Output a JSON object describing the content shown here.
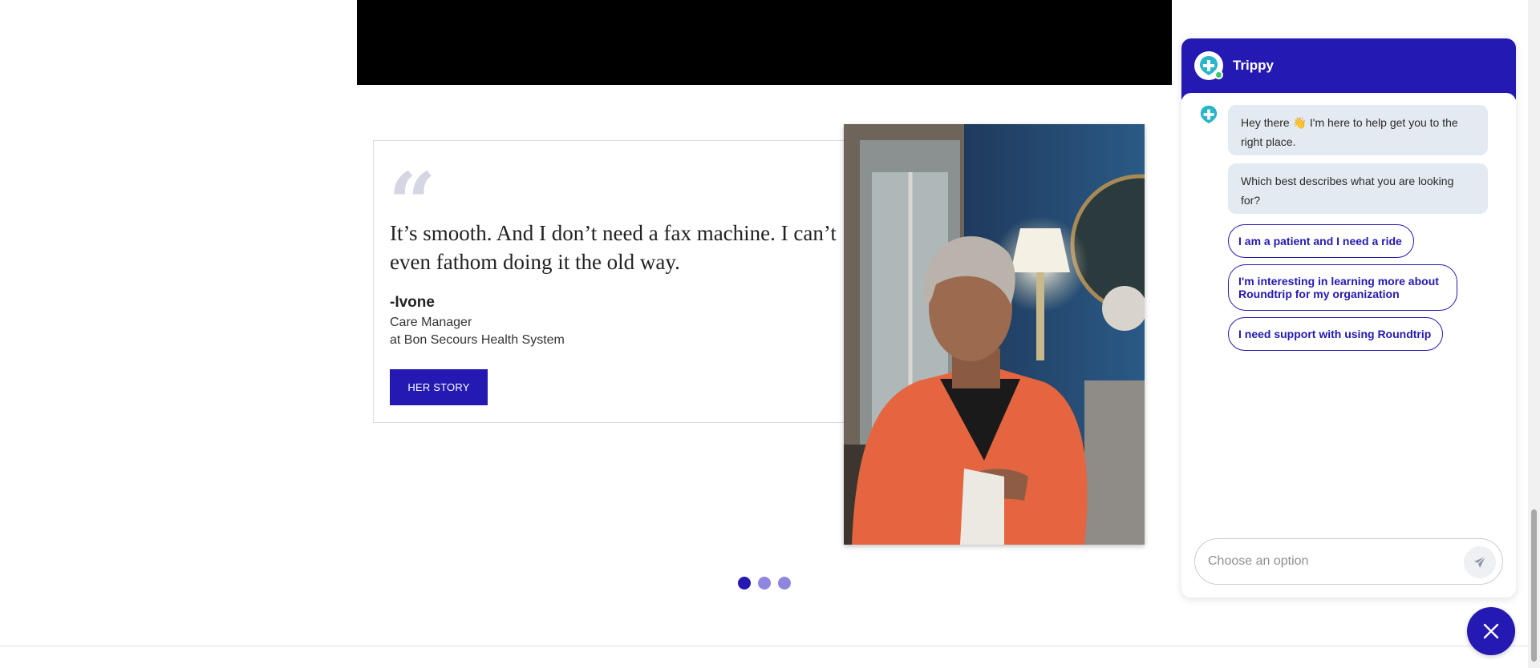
{
  "testimonial": {
    "quote_mark": "“",
    "quote": "It’s smooth. And I don’t need a fax machine. I can’t even fathom doing it the old way.",
    "author": "-Ivone",
    "role": "Care Manager",
    "organization": "at Bon Secours Health System",
    "button_label": "HER STORY"
  },
  "carousel": {
    "slides": 3,
    "active_index": 0
  },
  "chat": {
    "bot_name": "Trippy",
    "messages": [
      "Hey there 👋 I'm here to help get you to the right place.",
      "Which best describes what you are looking for?"
    ],
    "options": [
      "I am a patient and I need a ride",
      "I'm interesting in learning more about Roundtrip for my organization",
      "I need support with using Roundtrip"
    ],
    "input_placeholder": "Choose an option"
  },
  "colors": {
    "brand": "#2419b2",
    "accent": "#2bb5c9",
    "online": "#3cc66b"
  },
  "icons": [
    "roundtrip-logo-icon",
    "send-icon",
    "close-icon"
  ]
}
